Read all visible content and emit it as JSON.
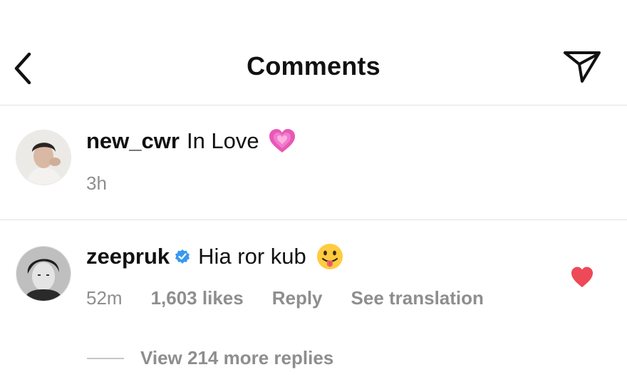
{
  "header": {
    "title": "Comments",
    "back_icon": "chevron-left-icon",
    "share_icon": "paper-plane-icon"
  },
  "caption": {
    "username": "new_cwr",
    "text": "In Love",
    "emoji": "💗",
    "time": "3h"
  },
  "comment": {
    "username": "zeepruk",
    "verified": true,
    "text": "Hia ror kub",
    "emoji": "😛",
    "time": "52m",
    "likes": "1,603 likes",
    "reply_label": "Reply",
    "translate_label": "See translation",
    "liked": true,
    "view_replies": "View 214 more replies"
  },
  "colors": {
    "text": "#111111",
    "muted": "#8e8e8e",
    "verified": "#3897f0",
    "heart": "#ed4956",
    "divider": "#e3e3e3"
  }
}
